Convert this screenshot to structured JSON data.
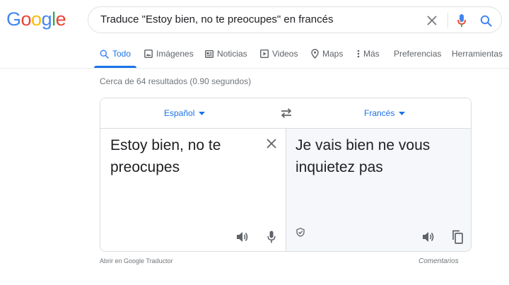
{
  "logo": {
    "letters": [
      "G",
      "o",
      "o",
      "g",
      "l",
      "e"
    ],
    "colors": [
      "#4285F4",
      "#EA4335",
      "#FBBC05",
      "#4285F4",
      "#34A853",
      "#EA4335"
    ]
  },
  "search": {
    "query": "Traduce \"Estoy bien, no te preocupes\" en francés"
  },
  "tabs": [
    {
      "label": "Todo",
      "icon": "search-icon",
      "active": true
    },
    {
      "label": "Imágenes",
      "icon": "image-icon"
    },
    {
      "label": "Noticias",
      "icon": "news-icon"
    },
    {
      "label": "Videos",
      "icon": "video-icon"
    },
    {
      "label": "Maps",
      "icon": "map-pin-icon"
    },
    {
      "label": "Más",
      "icon": "more-vert-icon"
    },
    {
      "label": "Preferencias"
    },
    {
      "label": "Herramientas"
    }
  ],
  "result_stats": "Cerca de 64 resultados (0.90 segundos)",
  "translate": {
    "source_lang": "Español",
    "target_lang": "Francés",
    "source_text": "Estoy bien, no te preocupes",
    "target_text": "Je vais bien ne vous inquietez pas"
  },
  "footer": {
    "open_link": "Abrir en Google Traductor",
    "feedback": "Comentarios"
  },
  "colors": {
    "accent": "#1a73e8",
    "muted": "#70757a",
    "icon": "#5f6368"
  }
}
